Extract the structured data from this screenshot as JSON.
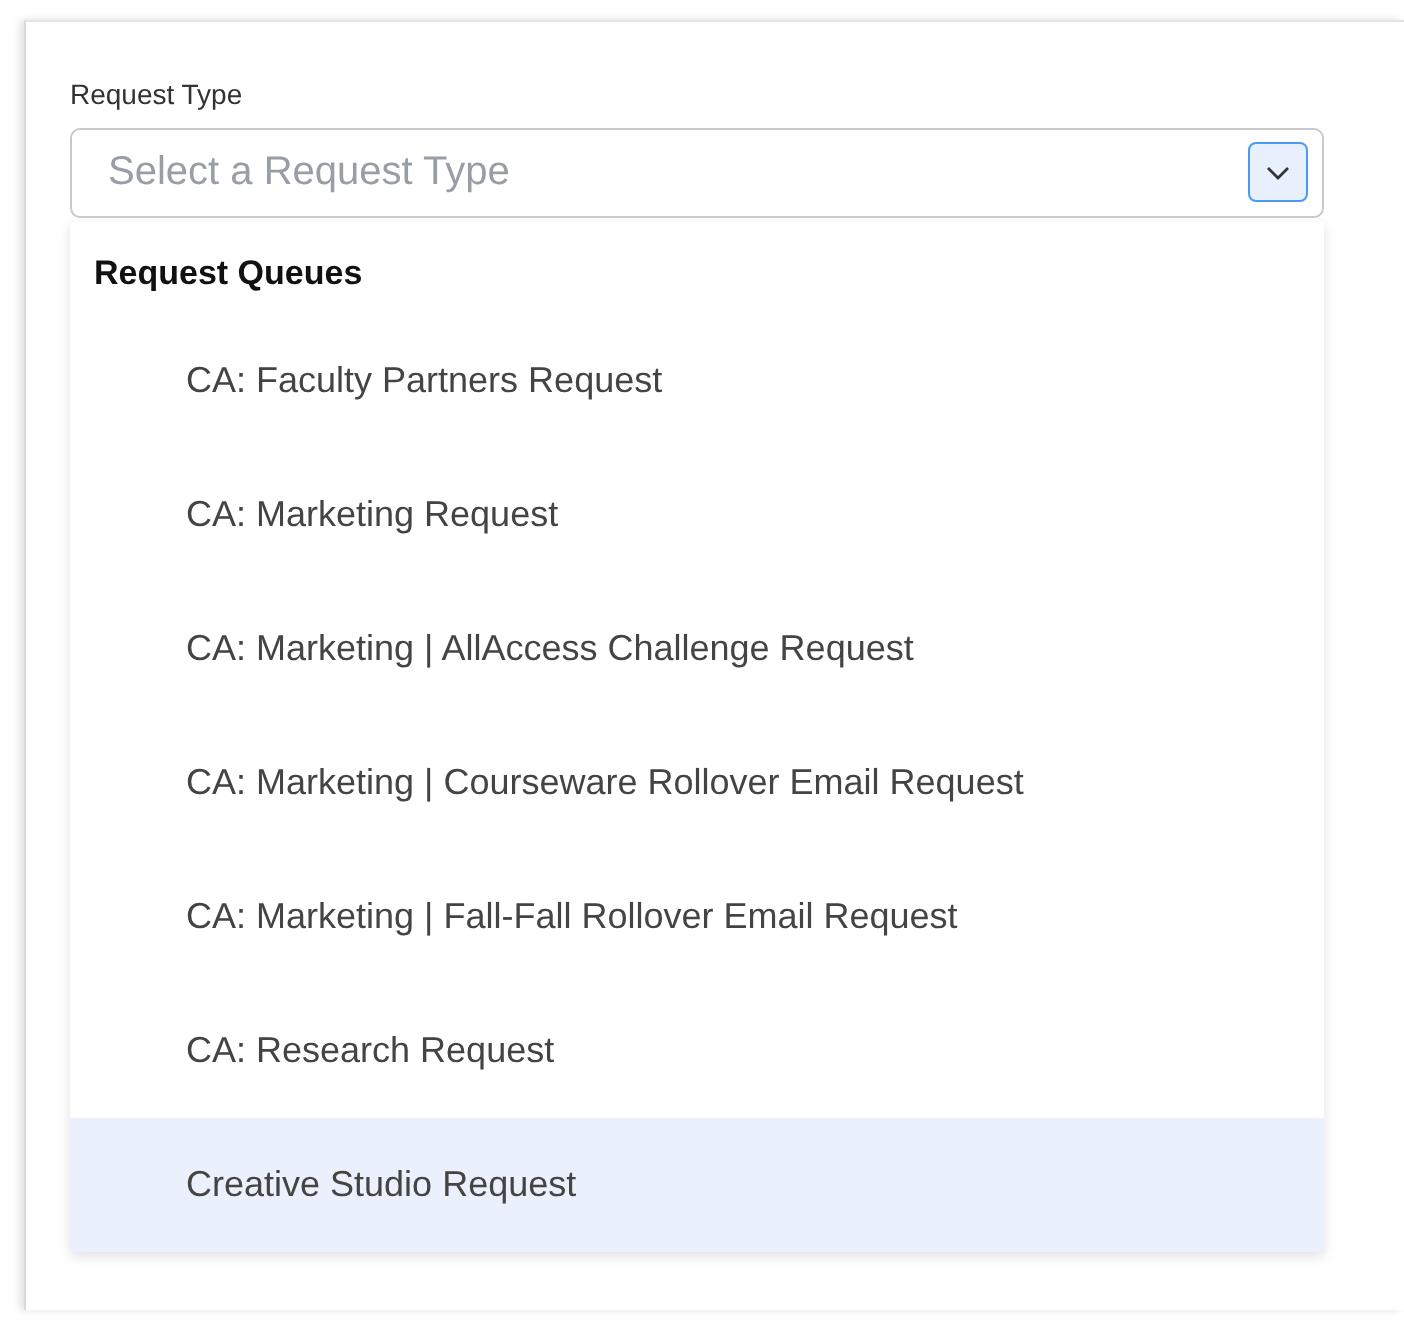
{
  "field": {
    "label": "Request Type",
    "placeholder": "Select a Request Type",
    "expanded": true
  },
  "dropdown": {
    "group_header": "Request Queues",
    "options": [
      {
        "label": "CA: Faculty Partners Request",
        "selected": false
      },
      {
        "label": "CA: Marketing Request",
        "selected": false
      },
      {
        "label": "CA: Marketing | AllAccess Challenge Request",
        "selected": false
      },
      {
        "label": "CA: Marketing | Courseware Rollover Email Request",
        "selected": false
      },
      {
        "label": "CA: Marketing | Fall-Fall Rollover Email Request",
        "selected": false
      },
      {
        "label": "CA: Research Request",
        "selected": false
      },
      {
        "label": "Creative Studio Request",
        "selected": true
      }
    ]
  }
}
